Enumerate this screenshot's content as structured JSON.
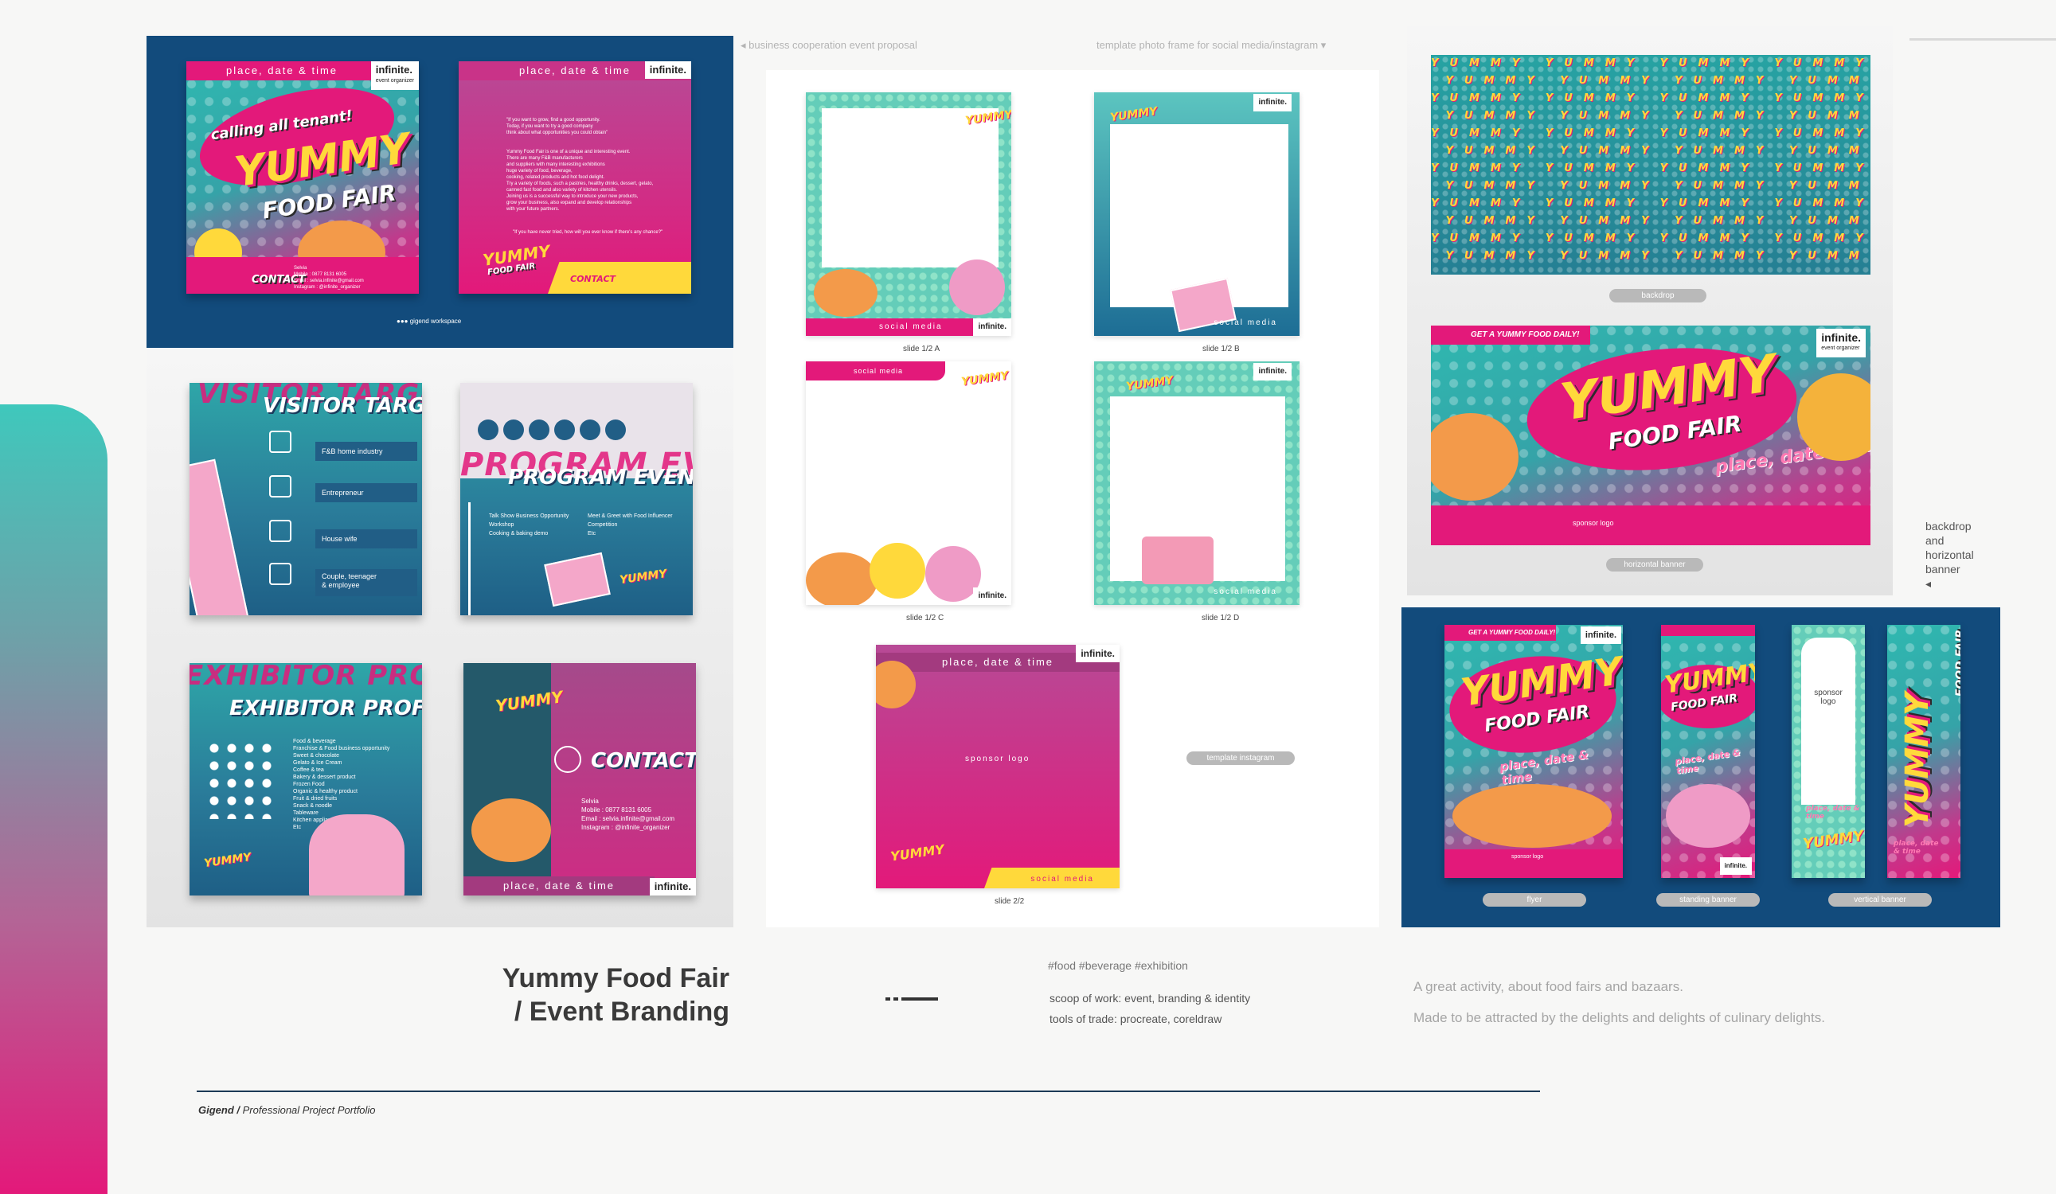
{
  "top_notes": {
    "proposal": "◂ business cooperation event proposal",
    "frame": "template photo frame for social media/instagram ▾"
  },
  "poster": {
    "bar": "place, date & time",
    "brand": "infinite.",
    "brand_sub": "event organizer",
    "tagline": "calling all tenant!",
    "title": "YUMMY",
    "subtitle": "FOOD FAIR",
    "contact": "CONTACT",
    "contact_lines": "Selvia\nMobile : 0877 8131 6005\nEmail : selvia.infinite@gmail.com\nInstagram : @infinite_organizer",
    "workspace": "gigend workspace"
  },
  "letter": {
    "bar": "place, date & time",
    "brand": "infinite.",
    "intro": "\"If you want to grow, find a good opportunity.\nToday, if you want to try a good company\nthink about what opportunities you could obtain\"",
    "body": "Yummy Food Fair is one of a unique and interesting event.\nThere are many F&B manufacturers\nand suppliers with many interesting exhibitions\nhuge variety of food, beverage,\ncooking, related products and hot food delight.\nTry a variety of foods, such a pastries, healthy drinks, dessert, gelato,\ncanned fast food and also variety of kitchen utensils.\nJoining us is a successful way to introduce your new products,\ngrow your business, also expand and develop relationships\nwith your future partners.",
    "quote": "\"If you have never tried, how will you ever know if there's any chance?\"",
    "mini_title": "YUMMY",
    "mini_sub": "FOOD FAIR",
    "contact": "CONTACT"
  },
  "visitor": {
    "ghost": "VISITOR TARGET",
    "title": "VISITOR TARGET",
    "items": [
      "F&B home industry",
      "Entrepreneur",
      "House wife",
      "Couple, teenager\n& employee"
    ]
  },
  "program": {
    "ghost": "PROGRAM EVENT",
    "title": "PROGRAM EVENT",
    "left": "Talk Show Business Opportunity\nWorkshop\nCooking & baking demo",
    "right": "Meet & Greet with Food Influencer\nCompetition\nEtc"
  },
  "exhibitor": {
    "ghost": "EXHIBITOR PROFILE",
    "title": "EXHIBITOR PROFILE",
    "list": "Food & beverage\nFranchise & Food business opportunity\nSweet & chocolate\nGelato & Ice Cream\nCoffee & tea\nBakery & dessert product\nFrozen Food\nOrganic & healthy product\nFruit & dried fruits\nSnack & noodle\nTableware\nKitchen appliances\nEtc"
  },
  "contact_card": {
    "title": "CONTACT",
    "lines": "Selvia\nMobile : 0877 8131 6005\nEmail : selvia.infinite@gmail.com\nInstagram : @infinite_organizer",
    "bar": "place, date & time",
    "brand": "infinite."
  },
  "frames": {
    "social": "social media",
    "brand": "infinite.",
    "captions": [
      "slide 1/2 A",
      "slide 1/2 B",
      "slide 1/2 C",
      "slide 1/2 D",
      "slide 2/2"
    ],
    "insta_bar": "place, date & time",
    "sponsor": "sponsor logo",
    "template_pill": "template instagram"
  },
  "right": {
    "backdrop_pill": "backdrop",
    "banner_ribbon": "GET A YUMMY FOOD DAILY!",
    "banner_title": "YUMMY",
    "banner_sub": "FOOD FAIR",
    "banner_place": "place, date & time",
    "banner_sponsor": "sponsor logo",
    "banner_pill": "horizontal banner",
    "side_note": "backdrop\nand\nhorizontal\nbanner\n◂",
    "flyer_pill": "flyer",
    "standing_pill": "standing banner",
    "vertical_pill": "vertical banner",
    "sponsor_logo": "sponsor\nlogo"
  },
  "info": {
    "title_line1": "Yummy Food Fair",
    "title_line2": "/ Event Branding",
    "tags": "#food #beverage #exhibition",
    "scope": "scoop of work: event, branding & identity",
    "tools": "tools of trade: procreate, coreldraw",
    "desc1": "A great activity, about food fairs and bazaars.",
    "desc2": "Made to be attracted by the delights and delights of culinary delights."
  },
  "footer": {
    "brand": "Gigend /",
    "text": "Professional Project Portfolio"
  },
  "colors": {
    "navy": "#124b7c",
    "magenta": "#e3197a",
    "teal": "#2fb8b0",
    "yellow": "#ffd93b"
  }
}
